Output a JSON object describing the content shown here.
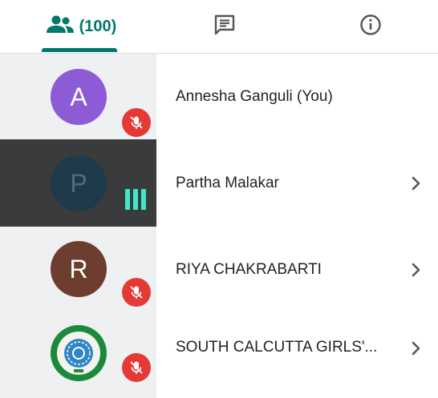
{
  "tabs": {
    "people_count": "(100)",
    "people_icon": "people-icon",
    "chat_icon": "chat-icon",
    "info_icon": "info-icon",
    "accent": "#00796b"
  },
  "participants": [
    {
      "initial": "A",
      "name": "Annesha Ganguli (You)",
      "avatar_color": "#8e5bd6",
      "status": "muted"
    },
    {
      "initial": "P",
      "name": "Partha Malakar",
      "avatar_color": "#1f3a4a",
      "status": "speaking"
    },
    {
      "initial": "R",
      "name": "RIYA CHAKRABARTI",
      "avatar_color": "#6d3e30",
      "status": "muted"
    },
    {
      "initial": "",
      "name": "SOUTH CALCUTTA GIRLS'...",
      "avatar_color": "#1b8a3a",
      "status": "muted"
    }
  ],
  "colors": {
    "mute_badge": "#e53935",
    "speaking_bars": "#3ee8c8",
    "active_tile": "#3a3b3c",
    "tile": "#eef0f2"
  }
}
